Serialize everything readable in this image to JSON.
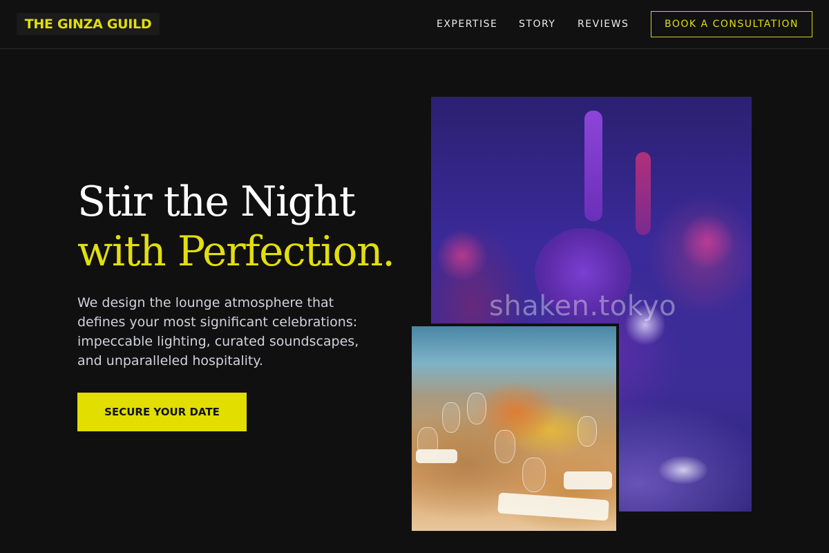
{
  "nav": {
    "logo": "THE GINZA GUILD",
    "links": [
      "EXPERTISE",
      "STORY",
      "REVIEWS"
    ],
    "cta": "BOOK A CONSULTATION"
  },
  "hero": {
    "title_line1": "Stir the Night",
    "title_line2": "with Perfection.",
    "subtitle": "We design the lounge atmosphere that defines your most significant celebrations: impeccable lighting, curated soundscapes, and unparalleled hospitality.",
    "cta": "SECURE YOUR DATE"
  },
  "gallery": {
    "watermark": "shaken.tokyo"
  },
  "colors": {
    "background": "#101010",
    "accent": "#e1de0e",
    "text": "#ffffff"
  }
}
